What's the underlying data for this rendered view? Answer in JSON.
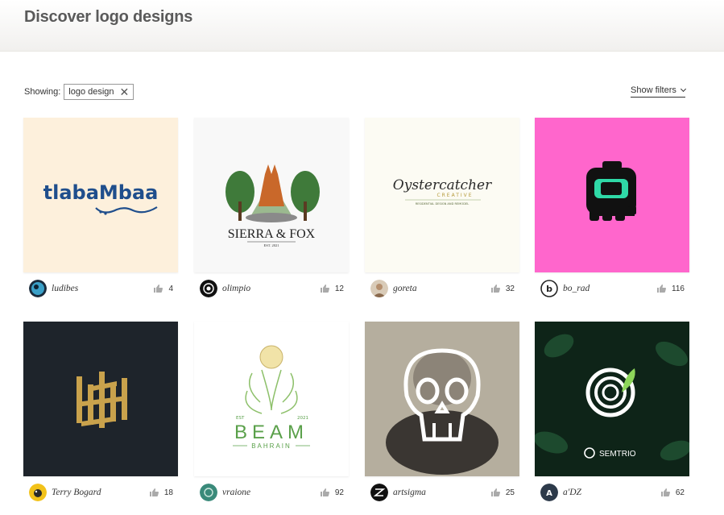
{
  "page": {
    "title": "Discover logo designs"
  },
  "filters": {
    "showing_label": "Showing:",
    "active_chip": "logo design",
    "show_filters_label": "Show filters"
  },
  "colors": {
    "accent_pink": "#ff66cc",
    "brand_blue": "#1f4e8c",
    "gold": "#c9a24c"
  },
  "cards": [
    {
      "designer": "ludibes",
      "likes": "4",
      "logo_text": "tlabaMbaa",
      "bg": "#fdf0dc"
    },
    {
      "designer": "olimpio",
      "likes": "12",
      "logo_text": "SIERRA & FOX",
      "logo_sub": "EST. 2021",
      "bg": "#f8f8f8"
    },
    {
      "designer": "goreta",
      "likes": "32",
      "logo_text": "Oystercatcher",
      "logo_sub": "CREATIVE",
      "logo_sub2": "RESIDENTIAL DESIGN AND REMODEL",
      "bg": "#fcfbf3"
    },
    {
      "designer": "bo_rad",
      "likes": "116",
      "bg": "#ff66cc"
    },
    {
      "designer": "Terry Bogard",
      "likes": "18",
      "bg": "#1e242b"
    },
    {
      "designer": "vraione",
      "likes": "92",
      "logo_text": "BEAM",
      "logo_sub": "BAHRAIN",
      "logo_est": "EST",
      "logo_year": "2021",
      "bg": "#ffffff"
    },
    {
      "designer": "artsigma",
      "likes": "25",
      "bg": "#b5ae9e"
    },
    {
      "designer": "a'DZ",
      "likes": "62",
      "logo_text": "SEMTRIO",
      "bg": "#0e2418"
    }
  ]
}
